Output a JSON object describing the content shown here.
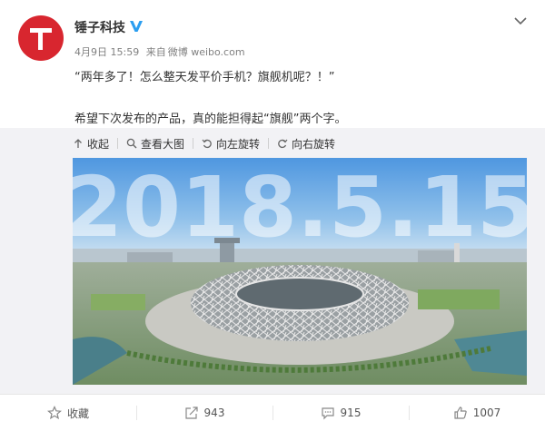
{
  "post": {
    "username": "锤子科技",
    "date": "4月9日 15:59",
    "source_prefix": "来自",
    "source": "微博 weibo.com",
    "text_line1": "“两年多了！怎么整天发平价手机？旗舰机呢？！”",
    "text_line2": "希望下次发布的产品，真的能担得起“旗舰”两个字。"
  },
  "media_toolbar": {
    "collapse": "收起",
    "view_large": "查看大图",
    "rotate_left": "向左旋转",
    "rotate_right": "向右旋转"
  },
  "image": {
    "overlay_text": "2018.5.15"
  },
  "actions": {
    "favorite": "收藏",
    "repost_count": "943",
    "comment_count": "915",
    "like_count": "1007"
  },
  "colors": {
    "brand_red": "#d8262f",
    "verified_blue": "#2b9ef0"
  }
}
